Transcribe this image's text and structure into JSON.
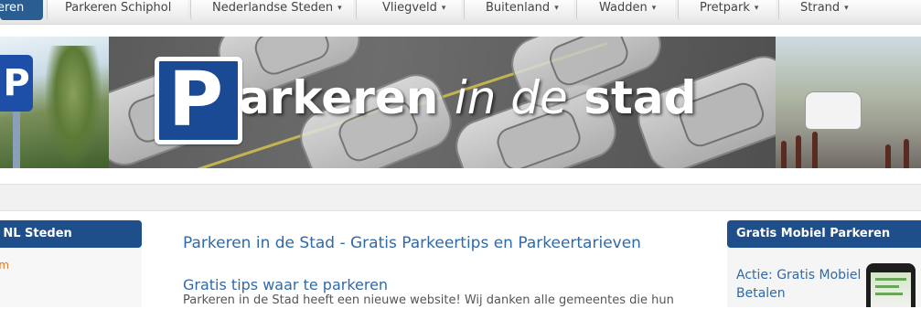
{
  "nav": {
    "items": [
      {
        "label": "eren",
        "dropdown": false,
        "active": true
      },
      {
        "label": "Parkeren Schiphol",
        "dropdown": false,
        "active": false
      },
      {
        "label": "Nederlandse Steden",
        "dropdown": true,
        "active": false
      },
      {
        "label": "Vliegveld",
        "dropdown": true,
        "active": false
      },
      {
        "label": "Buitenland",
        "dropdown": true,
        "active": false
      },
      {
        "label": "Wadden",
        "dropdown": true,
        "active": false
      },
      {
        "label": "Pretpark",
        "dropdown": true,
        "active": false
      },
      {
        "label": "Strand",
        "dropdown": true,
        "active": false
      }
    ],
    "caret_glyph": "▾"
  },
  "banner": {
    "logo_letter": "P",
    "title_part1": "arkeren",
    "title_part2": "in de",
    "title_part3": "stad",
    "left_sign_letter": "P"
  },
  "left": {
    "heading": "e NL Steden",
    "link": "am"
  },
  "main": {
    "title": "Parkeren in de Stad - Gratis Parkeertips en Parkeertarieven",
    "subtitle": "Gratis tips waar te parkeren",
    "paragraph": "Parkeren in de Stad heeft een nieuwe website! Wij danken alle gemeentes die hun"
  },
  "right": {
    "heading": "Gratis Mobiel Parkeren",
    "link": "Actie: Gratis Mobiel Betalen"
  },
  "colors": {
    "nav_active": "#2a5e93",
    "box_header": "#1f4f8b",
    "link_blue": "#2f6aa8",
    "link_orange": "#e8761a",
    "logo_blue": "#1b4a94"
  }
}
